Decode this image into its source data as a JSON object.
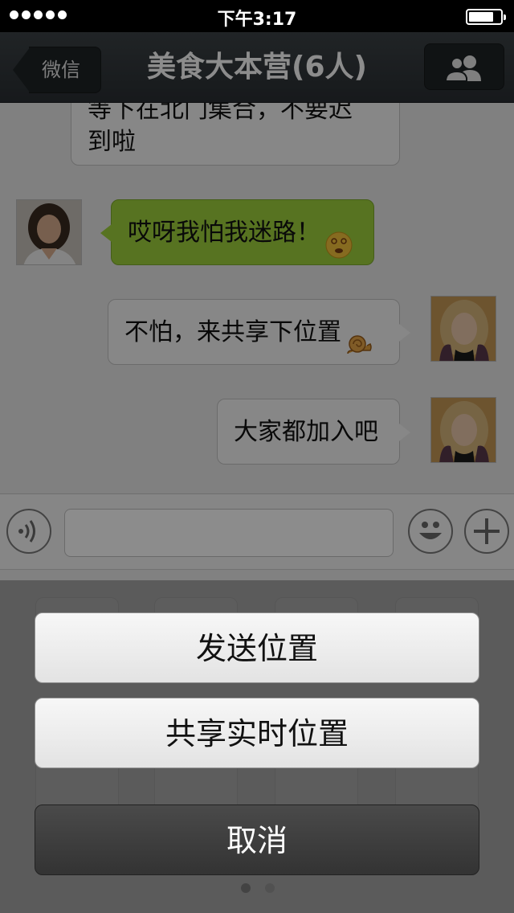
{
  "status_bar": {
    "time": "下午3:17",
    "signal_bars": 5
  },
  "nav": {
    "back_label": "微信",
    "title": "美食大本营(6人)",
    "contacts_icon": "group-icon"
  },
  "messages": [
    {
      "side": "other",
      "text_line1": "等下在北门集合，不要迟",
      "text_line2": "到啦"
    },
    {
      "side": "other",
      "text": "哎呀我怕我迷路！",
      "emoji": "dizzy-face-emoji"
    },
    {
      "side": "self",
      "text": "不怕，来共享下位置",
      "emoji": "snail-emoji"
    },
    {
      "side": "self",
      "text": "大家都加入吧"
    }
  ],
  "input_bar": {
    "voice_icon": "voice-icon",
    "emoji_icon": "smiley-icon",
    "plus_icon": "plus-icon",
    "value": ""
  },
  "action_sheet": {
    "send_location": "发送位置",
    "share_live_location": "共享实时位置",
    "cancel": "取消"
  },
  "colors": {
    "nav_bg": "#2f3438",
    "chat_bg": "#e9e9e9",
    "green_bubble": "#9ed13c",
    "cancel_bg": "#3a3a3a"
  }
}
